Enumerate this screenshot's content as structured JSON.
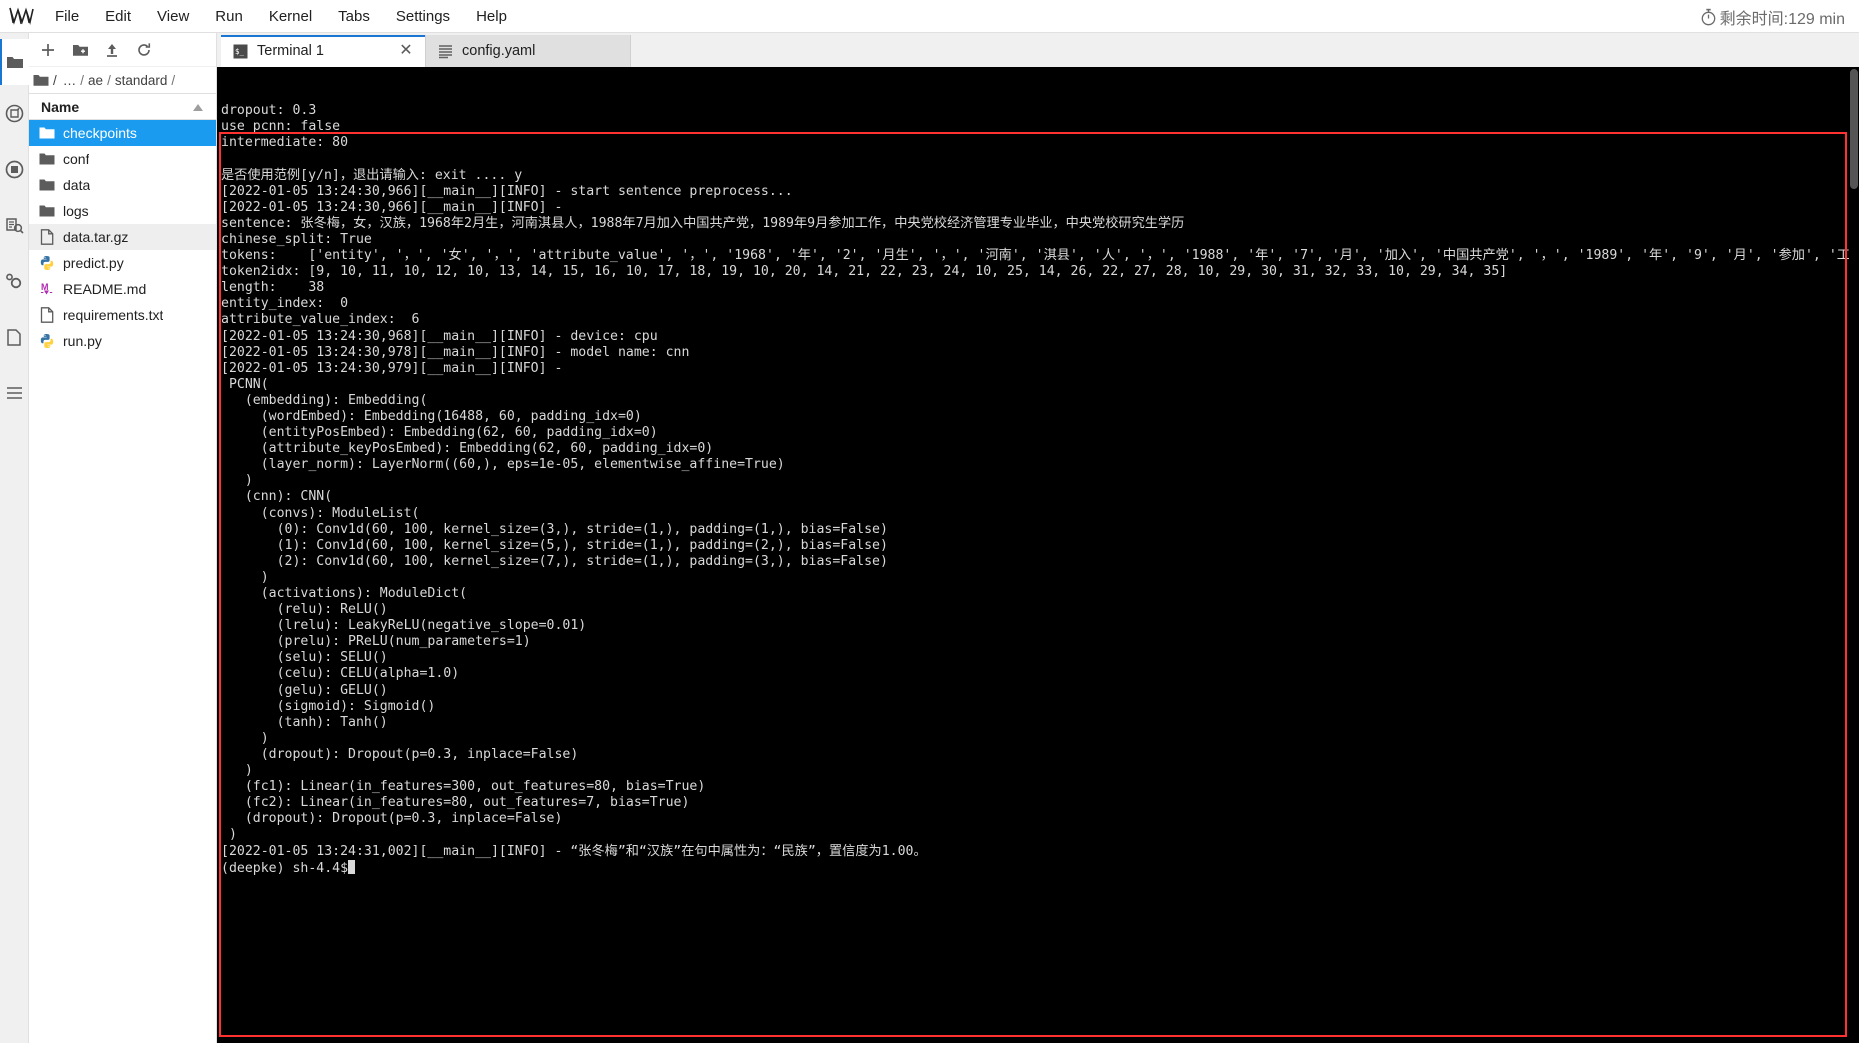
{
  "window": {
    "logo_icon": "jupyter-logo-icon",
    "timer_icon": "stopwatch-icon",
    "timer_text": "剩余时间:129 min",
    "accent_color": "#1976d2",
    "selected_color": "#1a9bf0",
    "highlight_border_color": "#ff3131"
  },
  "menubar": {
    "items": [
      {
        "label": "File"
      },
      {
        "label": "Edit"
      },
      {
        "label": "View"
      },
      {
        "label": "Run"
      },
      {
        "label": "Kernel"
      },
      {
        "label": "Tabs"
      },
      {
        "label": "Settings"
      },
      {
        "label": "Help"
      }
    ]
  },
  "activitybar": {
    "items": [
      {
        "name": "file-browser-icon",
        "active": true
      },
      {
        "name": "extension-manager-icon",
        "active": false
      },
      {
        "name": "running-terminals-icon",
        "active": false
      },
      {
        "name": "table-of-contents-search-icon",
        "active": false
      },
      {
        "name": "settings-gear-icon",
        "active": false
      },
      {
        "name": "open-tabs-icon",
        "active": false
      },
      {
        "name": "list-icon",
        "active": false
      }
    ]
  },
  "filebrowser": {
    "toolbar": [
      {
        "name": "new-launcher-button",
        "glyph": "+"
      },
      {
        "name": "new-folder-button",
        "glyph": "folder-plus"
      },
      {
        "name": "upload-button",
        "glyph": "upload"
      },
      {
        "name": "refresh-button",
        "glyph": "refresh"
      }
    ],
    "breadcrumb": {
      "home_icon": "folder-icon",
      "parts": [
        "/",
        "…",
        "/",
        "ae",
        "/",
        "standard",
        "/"
      ]
    },
    "column_header": "Name",
    "sort_icon": "sort-ascending-icon",
    "items": [
      {
        "name": "checkpoints",
        "type": "folder",
        "state": "selected"
      },
      {
        "name": "conf",
        "type": "folder",
        "state": "normal"
      },
      {
        "name": "data",
        "type": "folder",
        "state": "normal"
      },
      {
        "name": "logs",
        "type": "folder",
        "state": "normal"
      },
      {
        "name": "data.tar.gz",
        "type": "file",
        "state": "hovered"
      },
      {
        "name": "predict.py",
        "type": "python",
        "state": "normal"
      },
      {
        "name": "README.md",
        "type": "markdown",
        "state": "normal"
      },
      {
        "name": "requirements.txt",
        "type": "file",
        "state": "normal"
      },
      {
        "name": "run.py",
        "type": "python",
        "state": "normal"
      }
    ]
  },
  "tabs": [
    {
      "label": "Terminal 1",
      "icon": "terminal-icon",
      "active": true,
      "closable": true
    },
    {
      "label": "config.yaml",
      "icon": "yaml-file-icon",
      "active": false,
      "closable": true
    }
  ],
  "terminal": {
    "prompt": "(deepke) sh-4.4$",
    "lines_above_highlight": [
      "dropout: 0.3",
      "use_pcnn: false",
      "intermediate: 80",
      ""
    ],
    "lines": [
      "是否使用范例[y/n]，退出请输入: exit .... y",
      "[2022-01-05 13:24:30,966][__main__][INFO] - start sentence preprocess...",
      "[2022-01-05 13:24:30,966][__main__][INFO] - ",
      "sentence: 张冬梅，女，汉族，1968年2月生，河南淇县人，1988年7月加入中国共产党，1989年9月参加工作，中央党校经济管理专业毕业，中央党校研究生学历",
      "chinese_split: True",
      "tokens:    ['entity', '，', '女', '，', 'attribute_value', '，', '1968', '年', '2', '月生', '，', '河南', '淇县', '人', '，', '1988', '年', '7', '月', '加入', '中国共产党', '，', '1989', '年', '9', '月', '参加', '工作', '，', '中央党校', '经济', '管理', '专业', '毕业', '，', '中央党校', '研究生', '学历']",
      "token2idx: [9, 10, 11, 10, 12, 10, 13, 14, 15, 16, 10, 17, 18, 19, 10, 20, 14, 21, 22, 23, 24, 10, 25, 14, 26, 22, 27, 28, 10, 29, 30, 31, 32, 33, 10, 29, 34, 35]",
      "length:    38",
      "entity_index:  0",
      "attribute_value_index:  6",
      "[2022-01-05 13:24:30,968][__main__][INFO] - device: cpu",
      "[2022-01-05 13:24:30,978][__main__][INFO] - model name: cnn",
      "[2022-01-05 13:24:30,979][__main__][INFO] - ",
      " PCNN(",
      "   (embedding): Embedding(",
      "     (wordEmbed): Embedding(16488, 60, padding_idx=0)",
      "     (entityPosEmbed): Embedding(62, 60, padding_idx=0)",
      "     (attribute_keyPosEmbed): Embedding(62, 60, padding_idx=0)",
      "     (layer_norm): LayerNorm((60,), eps=1e-05, elementwise_affine=True)",
      "   )",
      "   (cnn): CNN(",
      "     (convs): ModuleList(",
      "       (0): Conv1d(60, 100, kernel_size=(3,), stride=(1,), padding=(1,), bias=False)",
      "       (1): Conv1d(60, 100, kernel_size=(5,), stride=(1,), padding=(2,), bias=False)",
      "       (2): Conv1d(60, 100, kernel_size=(7,), stride=(1,), padding=(3,), bias=False)",
      "     )",
      "     (activations): ModuleDict(",
      "       (relu): ReLU()",
      "       (lrelu): LeakyReLU(negative_slope=0.01)",
      "       (prelu): PReLU(num_parameters=1)",
      "       (selu): SELU()",
      "       (celu): CELU(alpha=1.0)",
      "       (gelu): GELU()",
      "       (sigmoid): Sigmoid()",
      "       (tanh): Tanh()",
      "     )",
      "     (dropout): Dropout(p=0.3, inplace=False)",
      "   )",
      "   (fc1): Linear(in_features=300, out_features=80, bias=True)",
      "   (fc2): Linear(in_features=80, out_features=7, bias=True)",
      "   (dropout): Dropout(p=0.3, inplace=False)",
      " )",
      "[2022-01-05 13:24:31,002][__main__][INFO] - “张冬梅”和“汉族”在句中属性为：“民族”，置信度为1.00。"
    ]
  }
}
